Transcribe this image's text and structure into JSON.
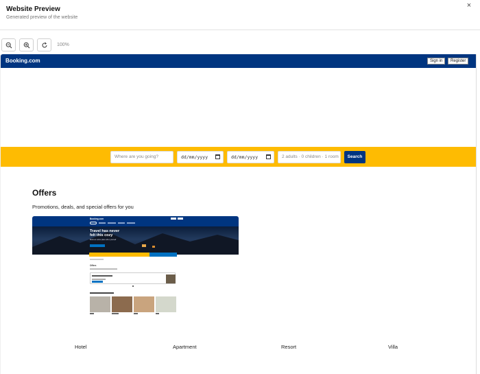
{
  "modal": {
    "title": "Website Preview",
    "subtitle": "Generated preview of the website",
    "close_glyph": "×"
  },
  "toolbar": {
    "zoom_out_icon": "zoom-out-icon",
    "zoom_in_icon": "zoom-in-icon",
    "refresh_icon": "refresh-icon",
    "zoom_level": "100%"
  },
  "site": {
    "logo": "Booking.com",
    "sign_in": "Sign in",
    "register": "Register",
    "brand_color": "#003580",
    "accent_color": "#febb02"
  },
  "search": {
    "destination_placeholder": "Where are you going?",
    "checkin_placeholder": "dd/mm/yyyy",
    "checkout_placeholder": "dd/mm/yyyy",
    "guests_value": "2 adults · 0 children · 1 room",
    "search_label": "Search"
  },
  "offers": {
    "title": "Offers",
    "subtitle": "Promotions, deals, and special offers for you"
  },
  "thumbnail": {
    "logo": "Booking.com",
    "hero_title_line1": "Travel has never",
    "hero_title_line2": "felt this cozy",
    "hero_sub": "Book an entire place all to yourself",
    "hero_btn": "Discover homes",
    "offers_title": "Offers",
    "offers_sub": "Promotions, deals, and special offers for you",
    "promo_title": "Take your longest holiday yet",
    "promo_btn": "Find a stay",
    "browse_title": "Browse by property type",
    "types": [
      "Hotels",
      "Apartments",
      "Resorts",
      "Villas"
    ]
  },
  "property_types": [
    "Hotel",
    "Apartment",
    "Resort",
    "Villa"
  ]
}
